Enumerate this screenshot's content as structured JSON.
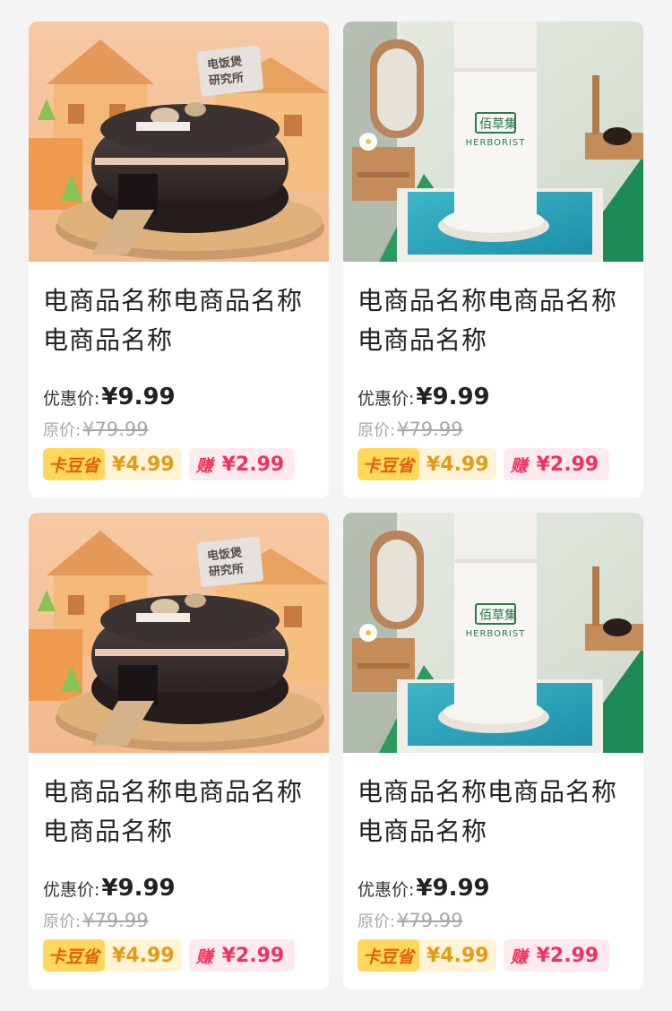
{
  "products": [
    {
      "image": "rice-cooker-scene",
      "image_sign": "电饭煲研究所",
      "title": "电商品名称电商品名称电商品名称",
      "price_label": "优惠价:",
      "price": "¥9.99",
      "original_label": "原价:",
      "original_price": "¥79.99",
      "save_tag": "卡豆省",
      "save_value": "¥4.99",
      "earn_tag": "赚",
      "earn_value": "¥2.99"
    },
    {
      "image": "herborist-bottle-scene",
      "image_brand_cn": "佰草集",
      "image_brand_en": "HERBORIST",
      "title": "电商品名称电商品名称电商品名称",
      "price_label": "优惠价:",
      "price": "¥9.99",
      "original_label": "原价:",
      "original_price": "¥79.99",
      "save_tag": "卡豆省",
      "save_value": "¥4.99",
      "earn_tag": "赚",
      "earn_value": "¥2.99"
    },
    {
      "image": "rice-cooker-scene",
      "image_sign": "电饭煲研究所",
      "title": "电商品名称电商品名称电商品名称",
      "price_label": "优惠价:",
      "price": "¥9.99",
      "original_label": "原价:",
      "original_price": "¥79.99",
      "save_tag": "卡豆省",
      "save_value": "¥4.99",
      "earn_tag": "赚",
      "earn_value": "¥2.99"
    },
    {
      "image": "herborist-bottle-scene",
      "image_brand_cn": "佰草集",
      "image_brand_en": "HERBORIST",
      "title": "电商品名称电商品名称电商品名称",
      "price_label": "优惠价:",
      "price": "¥9.99",
      "original_label": "原价:",
      "original_price": "¥79.99",
      "save_tag": "卡豆省",
      "save_value": "¥4.99",
      "earn_tag": "赚",
      "earn_value": "¥2.99"
    }
  ],
  "colors": {
    "background": "#f4f4f4",
    "card": "#ffffff",
    "save_tag_bg": "#ffd75a",
    "save_tag_text": "#e0620e",
    "earn_text": "#f0335e",
    "original_price": "#a8a8a8"
  }
}
